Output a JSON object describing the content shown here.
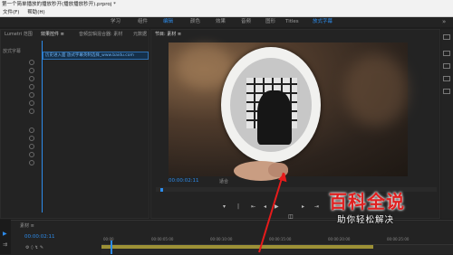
{
  "window": {
    "title": "第一个简单播放的播放秒开(播放播放秒开).prproj *"
  },
  "menu": {
    "items": [
      "文件(F)",
      "帮助(H)"
    ]
  },
  "workspace": {
    "tabs": [
      "学习",
      "组件",
      "编辑",
      "颜色",
      "效果",
      "音频",
      "图形",
      "Titles",
      "放式字幕"
    ],
    "active_index": 2,
    "more": "»"
  },
  "source_panel": {
    "tabs": [
      "Lumetri 范围",
      "效果控件 ≡",
      "音频剪辑混合器: 素材",
      "元数据"
    ],
    "clip_label": "历史进入面 放式字幕英制选择_www.baidu.com",
    "track_label": "放式字幕"
  },
  "program_panel": {
    "tab": "节目: 素材 ≡",
    "timecode": "00:00:02:11",
    "fit": "适合"
  },
  "timeline": {
    "tab": "素材 ≡",
    "timecode": "00:00:02:11",
    "ruler": [
      "00:00",
      "00:00:05:00",
      "00:00:10:00",
      "00:00:15:00",
      "00:00:20:00",
      "00:00:25:00",
      "00:00:30:00"
    ]
  },
  "watermark": {
    "title": "百科全说",
    "subtitle": "助你轻松解决"
  },
  "colors": {
    "accent": "#2d8ceb",
    "arrow": "#e61b1b",
    "watermark": "#e02020"
  },
  "icons": [
    "play-icon",
    "step-back-icon",
    "step-forward-icon",
    "export-frame-icon",
    "settings-icon",
    "add-icon"
  ]
}
